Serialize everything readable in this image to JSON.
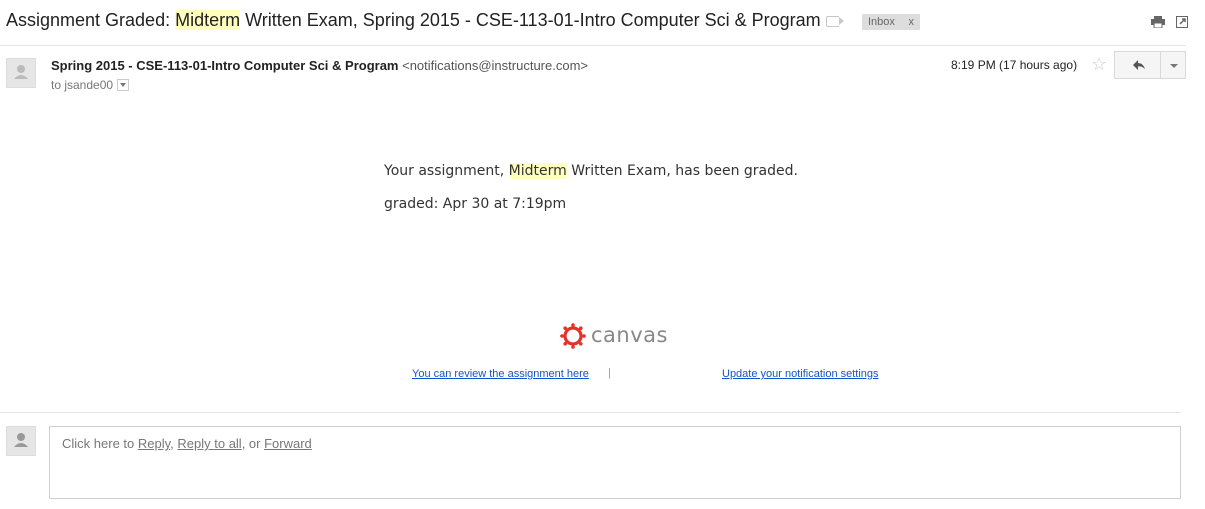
{
  "subject": {
    "prefix": "Assignment Graded: ",
    "highlight": "Midterm",
    "rest": " Written Exam, Spring 2015 - CSE-113-01-Intro Computer Sci & Program"
  },
  "label_chip": {
    "text": "Inbox",
    "close": "x"
  },
  "message": {
    "sender_name": "Spring 2015 - CSE-113-01-Intro Computer Sci & Program",
    "sender_email": "<notifications@instructure.com>",
    "to_prefix": "to ",
    "recipient": "jsande00",
    "timestamp": "8:19 PM (17 hours ago)",
    "star_glyph": "☆"
  },
  "body": {
    "line1_prefix": "Your assignment, ",
    "line1_highlight": "Midterm",
    "line1_rest": " Written Exam, has been graded.",
    "line2": "graded: Apr 30 at 7:19pm"
  },
  "brand": {
    "name": "canvas",
    "color": "#e4322a"
  },
  "footer": {
    "review_link": "You can review the assignment here",
    "separator": "|",
    "settings_link": "Update your notification settings"
  },
  "reply_box": {
    "prefix": "Click here to ",
    "reply": "Reply",
    "comma": ", ",
    "reply_all": "Reply to all",
    "or": ", or ",
    "forward": "Forward"
  },
  "icons": [
    "label-icon",
    "print-icon",
    "new-window-icon",
    "avatar-icon",
    "star-icon",
    "reply-arrow-icon",
    "dropdown-icon",
    "canvas-logo-icon"
  ]
}
